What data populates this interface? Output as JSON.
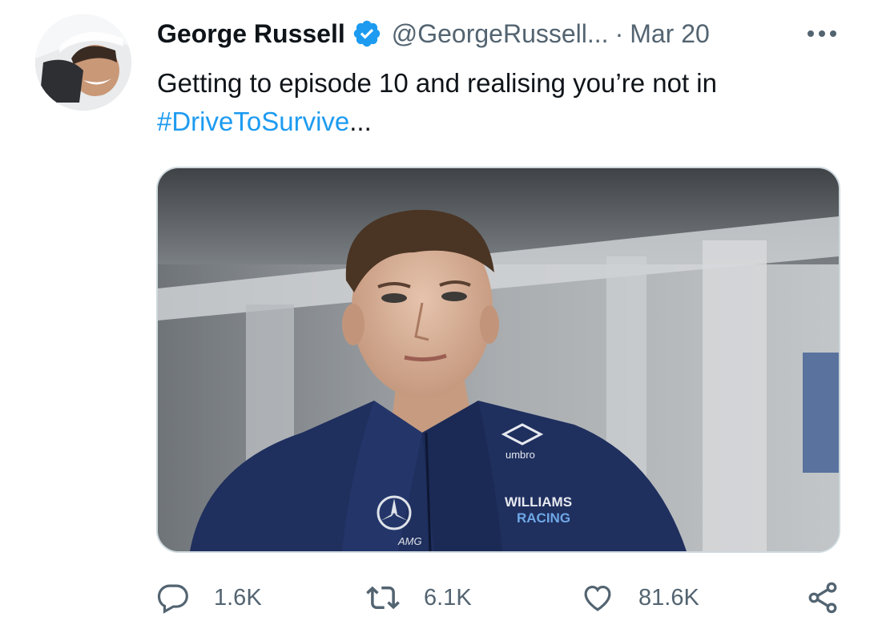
{
  "tweet": {
    "author_name": "George Russell",
    "handle": "@GeorgeRussell...",
    "separator": "·",
    "date": "Mar 20",
    "text_before": "Getting to episode 10 and realising you’re not in",
    "hashtag": "#DriveToSurvive",
    "text_after": "...",
    "verified": true
  },
  "media": {
    "logos": {
      "umbro": "umbro",
      "team_line1": "WILLIAMS",
      "team_line2": "RACING",
      "amg": "AMG"
    }
  },
  "actions": {
    "reply_count": "1.6K",
    "retweet_count": "6.1K",
    "like_count": "81.6K"
  },
  "icons": {
    "more": "more-icon",
    "reply": "reply-icon",
    "retweet": "retweet-icon",
    "like": "heart-icon",
    "share": "share-icon",
    "verified": "verified-badge-icon"
  },
  "colors": {
    "link": "#1d9bf0",
    "secondary_text": "#536471",
    "primary_text": "#0f1419",
    "verified": "#1d9bf0",
    "jacket": "#1f2f5e"
  }
}
